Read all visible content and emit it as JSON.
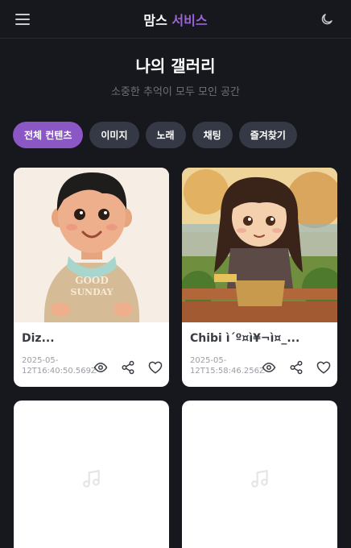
{
  "header": {
    "brand_main": "맘스",
    "brand_accent": "서비스",
    "menu_icon": "hamburger-menu-icon",
    "theme_icon": "moon-icon"
  },
  "page": {
    "title": "나의 갤러리",
    "subtitle": "소중한 추억이 모두 모인 공간"
  },
  "filters": [
    {
      "label": "전체 컨텐츠",
      "active": true
    },
    {
      "label": "이미지",
      "active": false
    },
    {
      "label": "노래",
      "active": false
    },
    {
      "label": "채팅",
      "active": false
    },
    {
      "label": "즐겨찾기",
      "active": false
    }
  ],
  "cards": [
    {
      "title": "Diz...",
      "date": "2025-05-12T16:40:50.569Z",
      "image": "illustration-boy-sweater",
      "badge": "GOOD SUNDAY"
    },
    {
      "title": "Chibi ì´º¤ì¥¬ì¤_...",
      "date": "2025-05-12T15:58:46.256Z",
      "image": "illustration-girl-on-bench"
    },
    {
      "title": "",
      "date": "",
      "image": "music-note-icon"
    },
    {
      "title": "",
      "date": "",
      "image": "music-note-icon"
    }
  ],
  "colors": {
    "background": "#17181d",
    "accent": "#8b57c4",
    "chip": "#353945",
    "card": "#ffffff"
  }
}
